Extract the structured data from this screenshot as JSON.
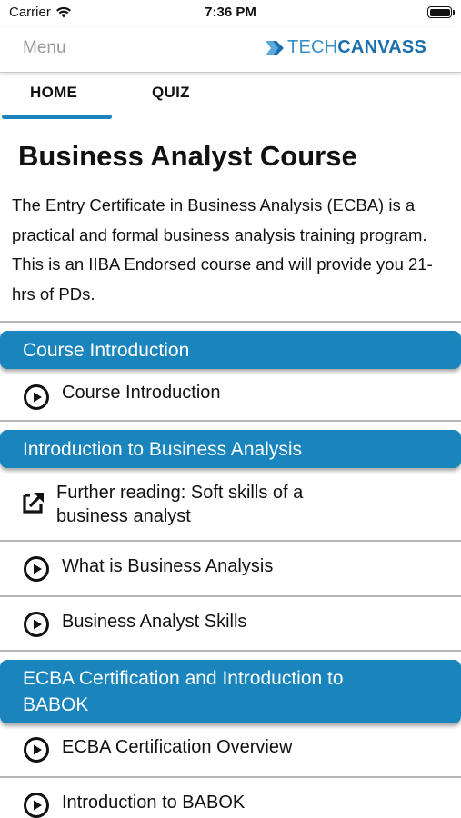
{
  "status": {
    "carrier": "Carrier",
    "time": "7:36 PM"
  },
  "nav": {
    "menu_label": "Menu",
    "logo_tech": "TECH",
    "logo_canvass": "CANVASS"
  },
  "tabs": [
    {
      "label": "HOME",
      "selected": true
    },
    {
      "label": "QUIZ",
      "selected": false
    }
  ],
  "course": {
    "title": "Business Analyst Course",
    "description": "The Entry Certificate in Business Analysis (ECBA) is a practical and formal business analysis training program. This is an IIBA Endorsed course and will provide you 21-hrs of PDs."
  },
  "sections": [
    {
      "title": "Course Introduction",
      "lessons": [
        {
          "label": "Course Introduction",
          "icon": "play-icon"
        }
      ]
    },
    {
      "title": "Introduction to Business Analysis",
      "lessons": [
        {
          "label": "Further reading: Soft skills of a business analyst",
          "icon": "external-link-icon"
        },
        {
          "label": "What is Business Analysis",
          "icon": "play-icon"
        },
        {
          "label": "Business Analyst Skills",
          "icon": "play-icon"
        }
      ]
    },
    {
      "title": "ECBA Certification and Introduction to BABOK",
      "lessons": [
        {
          "label": "ECBA Certification Overview",
          "icon": "play-icon"
        },
        {
          "label": "Introduction to BABOK",
          "icon": "play-icon"
        }
      ]
    }
  ],
  "colors": {
    "accent": "#1a85bd",
    "menu_text": "#9a9a9a",
    "divider": "#b5b5b5"
  }
}
